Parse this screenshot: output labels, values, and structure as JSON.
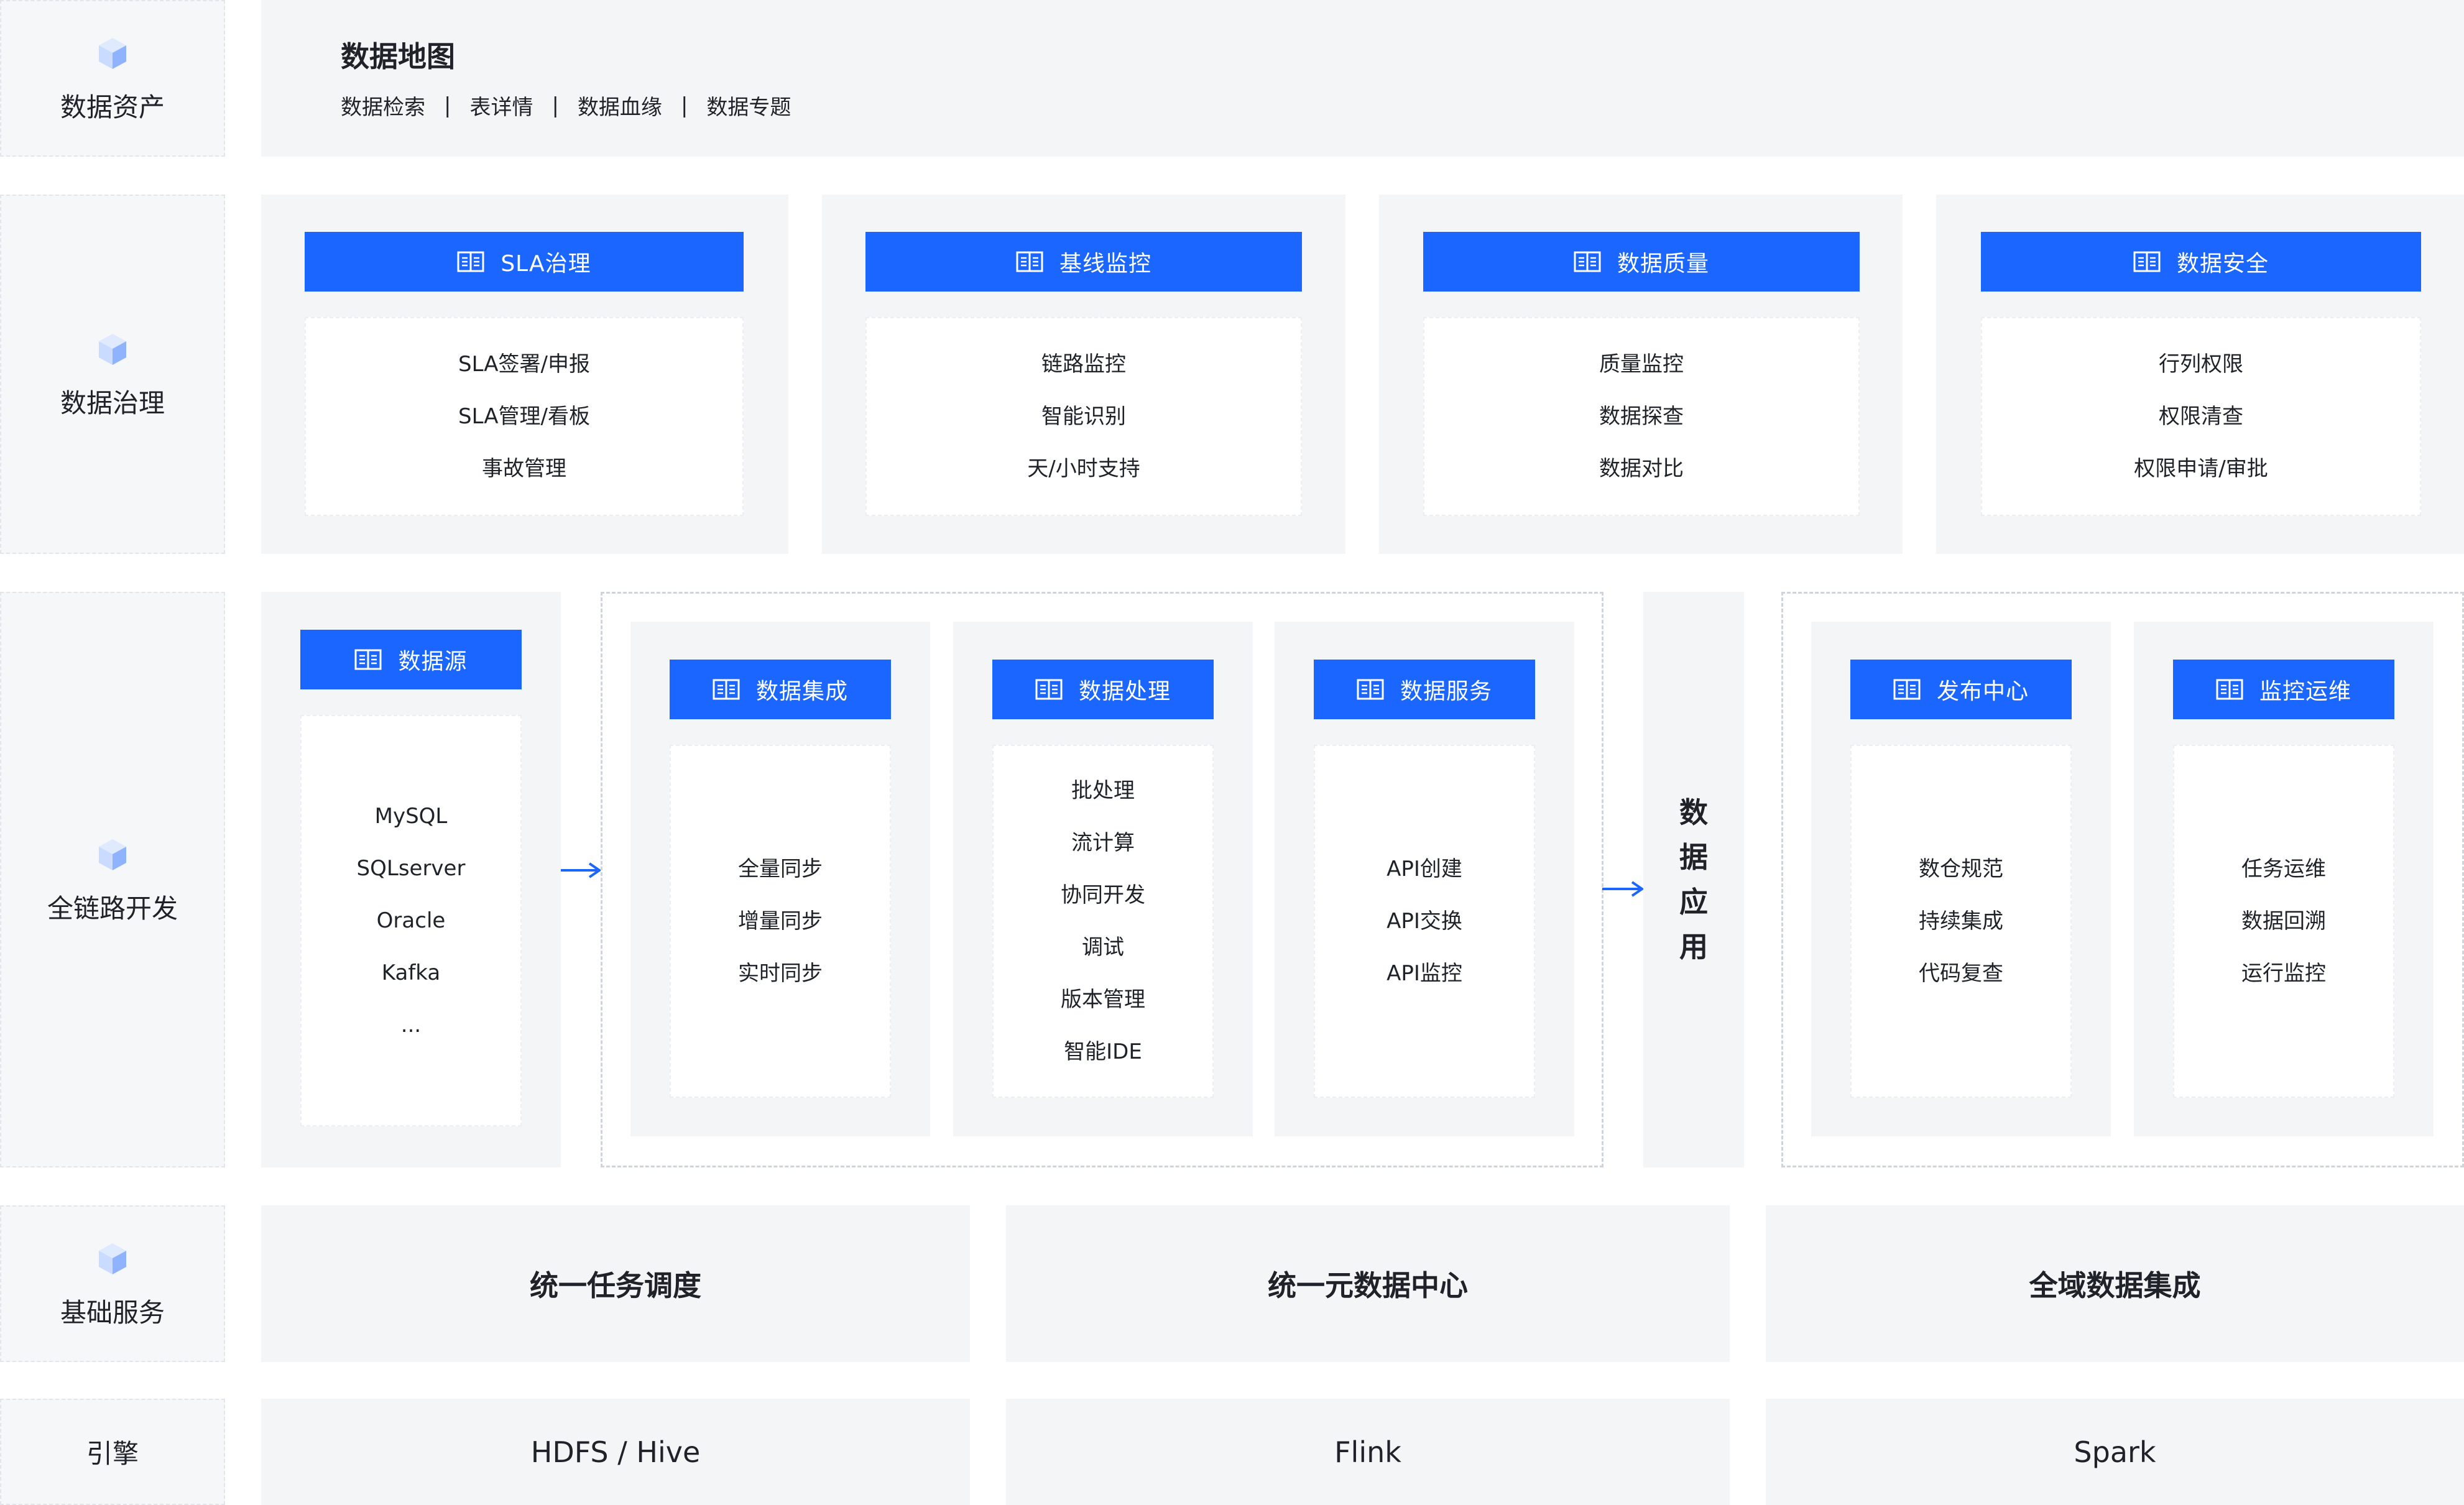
{
  "rows": {
    "assets": "数据资产",
    "governance": "数据治理",
    "fullchain": "全链路开发",
    "base": "基础服务",
    "engine": "引擎"
  },
  "map": {
    "title": "数据地图",
    "links": [
      "数据检索",
      "表详情",
      "数据血缘",
      "数据专题"
    ],
    "separator": "|"
  },
  "governance": [
    {
      "title": "SLA治理",
      "items": [
        "SLA签署/申报",
        "SLA管理/看板",
        "事故管理"
      ]
    },
    {
      "title": "基线监控",
      "items": [
        "链路监控",
        "智能识别",
        "天/小时支持"
      ]
    },
    {
      "title": "数据质量",
      "items": [
        "质量监控",
        "数据探查",
        "数据对比"
      ]
    },
    {
      "title": "数据安全",
      "items": [
        "行列权限",
        "权限清查",
        "权限申请/审批"
      ]
    }
  ],
  "source": {
    "title": "数据源",
    "items": [
      "MySQL",
      "SQLserver",
      "Oracle",
      "Kafka",
      "..."
    ]
  },
  "dev": [
    {
      "title": "数据集成",
      "items": [
        "全量同步",
        "增量同步",
        "实时同步"
      ]
    },
    {
      "title": "数据处理",
      "items": [
        "批处理",
        "流计算",
        "协同开发",
        "调试",
        "版本管理",
        "智能IDE"
      ]
    },
    {
      "title": "数据服务",
      "items": [
        "API创建",
        "API交换",
        "API监控"
      ]
    }
  ],
  "app": {
    "chars": [
      "数",
      "据",
      "应",
      "用"
    ]
  },
  "ops": [
    {
      "title": "发布中心",
      "items": [
        "数仓规范",
        "持续集成",
        "代码复查"
      ]
    },
    {
      "title": "监控运维",
      "items": [
        "任务运维",
        "数据回溯",
        "运行监控"
      ]
    }
  ],
  "base": [
    "统一任务调度",
    "统一元数据中心",
    "全域数据集成"
  ],
  "engine": [
    "HDFS / Hive",
    "Flink",
    "Spark"
  ],
  "colors": {
    "accent": "#1a66ff",
    "panel": "#f4f5f7",
    "label_bg": "#f6f7f9"
  },
  "icons": {
    "row": "cube-icon",
    "header": "book-icon",
    "flow": "arrow-right-icon"
  }
}
